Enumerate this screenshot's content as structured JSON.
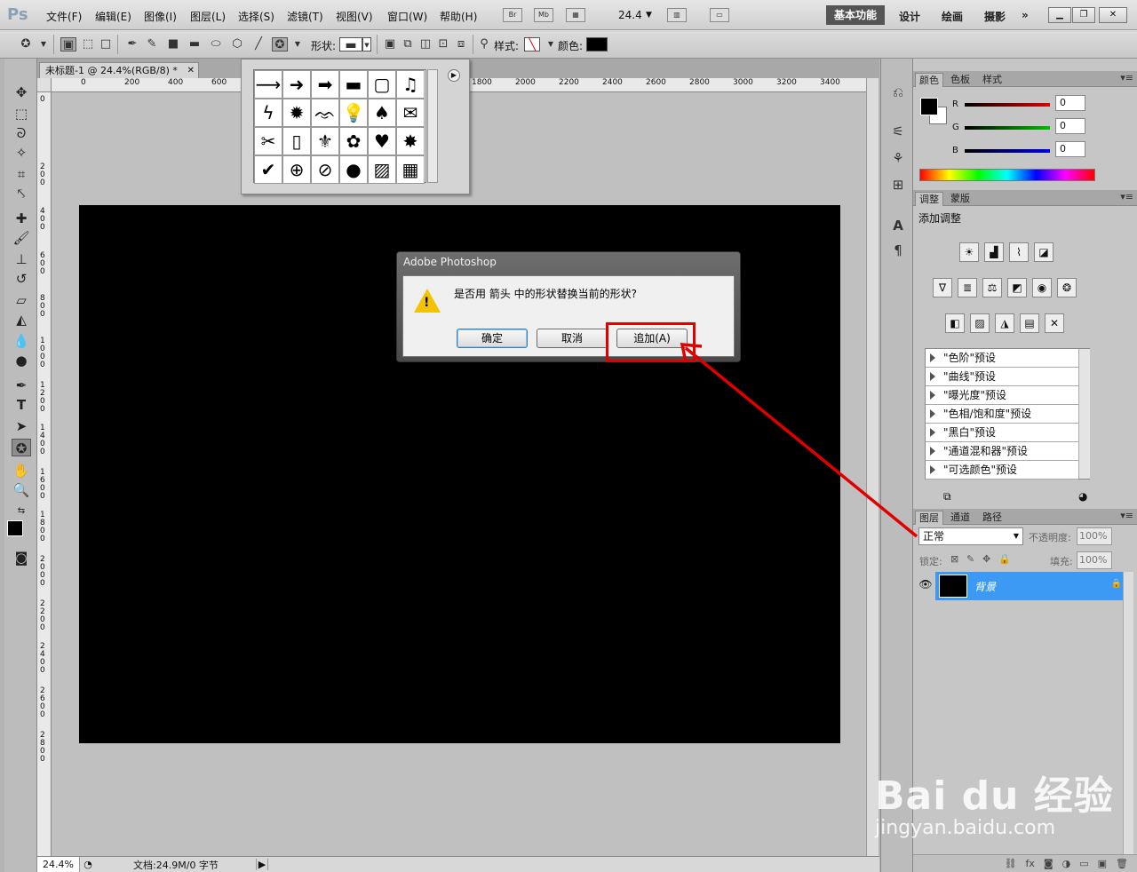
{
  "app": {
    "logo": "Ps",
    "menus": [
      "文件(F)",
      "编辑(E)",
      "图像(I)",
      "图层(L)",
      "选择(S)",
      "滤镜(T)",
      "视图(V)",
      "窗口(W)",
      "帮助(H)"
    ],
    "bridge_btn": "Br",
    "minibridge_btn": "Mb",
    "zoom": "24.4",
    "workspace_active": "基本功能",
    "workspaces": [
      "设计",
      "绘画",
      "摄影"
    ]
  },
  "options": {
    "shape_label": "形状:",
    "style_label": "样式:",
    "color_label": "颜色:"
  },
  "document": {
    "tab_title": "未标题-1 @ 24.4%(RGB/8) *",
    "ruler_top": [
      "0",
      "200",
      "400",
      "600",
      "1800",
      "2000",
      "2200",
      "2400",
      "2600",
      "2800",
      "3000",
      "3200",
      "3400"
    ],
    "ruler_left": [
      "0",
      "2 0 0",
      "4 0 0",
      "6 0 0",
      "8 0 0",
      "1 0 0 0",
      "1 2 0 0",
      "1 4 0 0",
      "1 6 0 0",
      "1 8 0 0",
      "2 0 0 0",
      "2 2 0 0",
      "2 4 0 0",
      "2 6 0 0",
      "2 8 0 0"
    ],
    "status_zoom": "24.4%",
    "status_doc": "文档:24.9M/0 字节"
  },
  "shape_picker": {
    "shapes": [
      "⟶",
      "➜",
      "➡",
      "▬",
      "▢",
      "♫",
      "ϟ",
      "✹",
      "ᨎ",
      "💡",
      "♠",
      "✉",
      "✂",
      "▯",
      "⚜",
      "✿",
      "♥",
      "✸",
      "✔",
      "⊕",
      "⊘",
      "●",
      "▨",
      "▦"
    ],
    "menu_glyph": "▶"
  },
  "dialog": {
    "title": "Adobe Photoshop",
    "message": "是否用 箭头 中的形状替换当前的形状?",
    "ok_label": "确定",
    "cancel_label": "取消",
    "append_label": "追加(A)"
  },
  "color_panel": {
    "tabs": [
      "颜色",
      "色板",
      "样式"
    ],
    "channels": [
      {
        "label": "R",
        "value": "0",
        "color": "#e00000"
      },
      {
        "label": "G",
        "value": "0",
        "color": "#00c000"
      },
      {
        "label": "B",
        "value": "0",
        "color": "#0000e0"
      }
    ],
    "foreground": "#000000",
    "background": "#ffffff"
  },
  "adjust_panel": {
    "tabs": [
      "调整",
      "蒙版"
    ],
    "heading": "添加调整",
    "presets": [
      "\"色阶\"预设",
      "\"曲线\"预设",
      "\"曝光度\"预设",
      "\"色相/饱和度\"预设",
      "\"黑白\"预设",
      "\"通道混和器\"预设",
      "\"可选颜色\"预设"
    ]
  },
  "layers_panel": {
    "tabs": [
      "图层",
      "通道",
      "路径"
    ],
    "blend_mode": "正常",
    "opacity_label": "不透明度:",
    "opacity": "100%",
    "lock_label": "锁定:",
    "fill_label": "填充:",
    "fill": "100%",
    "layer_name": "背景"
  },
  "watermark": {
    "brand": "Bai du 经验",
    "url": "jingyan.baidu.com"
  },
  "accent_colors": {
    "highlight": "#e00000",
    "layer_selected": "#3c9af5"
  }
}
